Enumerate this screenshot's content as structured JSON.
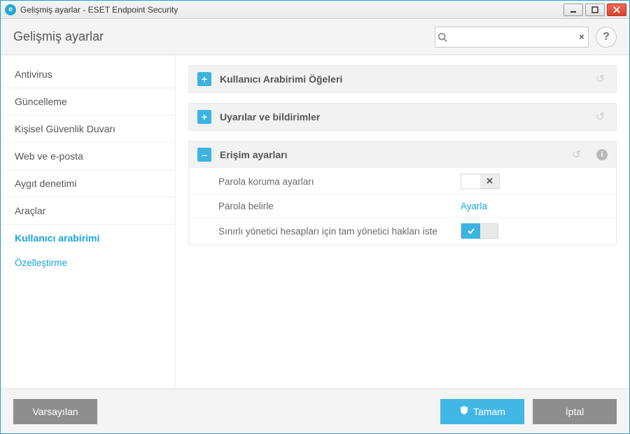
{
  "window": {
    "title": "Gelişmiş ayarlar - ESET Endpoint Security"
  },
  "header": {
    "page_title": "Gelişmiş ayarlar"
  },
  "search": {
    "placeholder": "",
    "value": "",
    "clear_label": "×"
  },
  "help": {
    "label": "?"
  },
  "sidebar": {
    "items": [
      {
        "label": "Antivirus",
        "active": false
      },
      {
        "label": "Güncelleme",
        "active": false
      },
      {
        "label": "Kişisel Güvenlik Duvarı",
        "active": false
      },
      {
        "label": "Web ve e-posta",
        "active": false
      },
      {
        "label": "Aygıt denetimi",
        "active": false
      },
      {
        "label": "Araçlar",
        "active": false
      },
      {
        "label": "Kullanıcı arabirimi",
        "active": true
      }
    ],
    "sub": {
      "label": "Özelleştirme"
    }
  },
  "sections": {
    "ui_elements": {
      "title": "Kullanıcı Arabirimi Öğeleri",
      "expanded": false,
      "expand_glyph": "+"
    },
    "alerts": {
      "title": "Uyarılar ve bildirimler",
      "expanded": false,
      "expand_glyph": "+"
    },
    "access": {
      "title": "Erişim ayarları",
      "expanded": true,
      "expand_glyph": "–",
      "rows": {
        "pw_protect": {
          "label": "Parola koruma ayarları",
          "state": "off",
          "x_glyph": "✕"
        },
        "set_pw": {
          "label": "Parola belirle",
          "action": "Ayarla"
        },
        "admin_rights": {
          "label": "Sınırlı yönetici hesapları için tam yönetici hakları iste",
          "state": "on"
        }
      }
    }
  },
  "footer": {
    "default": "Varsayılan",
    "ok": "Tamam",
    "cancel": "İptal"
  },
  "icons": {
    "reset": "↺",
    "info": "i",
    "check": "✓",
    "search": "🔍"
  }
}
